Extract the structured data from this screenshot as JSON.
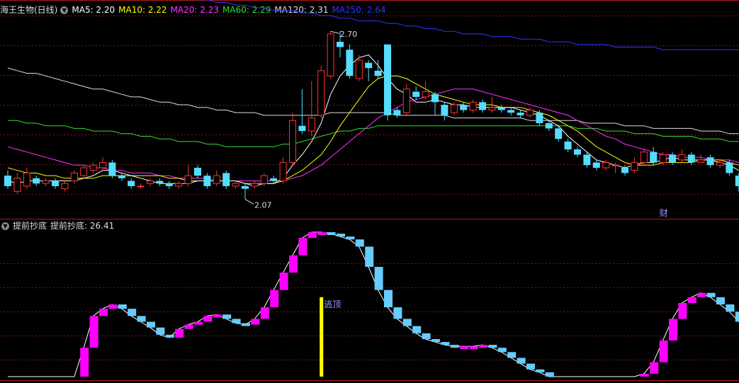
{
  "main_header": {
    "stock_name": "海王生物(日线)",
    "ma": [
      {
        "label": "MA5: 2.20",
        "color": "#ffffff"
      },
      {
        "label": "MA10: 2.22",
        "color": "#ffff00"
      },
      {
        "label": "MA20: 2.23",
        "color": "#ff33ff"
      },
      {
        "label": "MA60: 2.29",
        "color": "#33dd33"
      },
      {
        "label": "MA120: 2.31",
        "color": "#dddddd"
      },
      {
        "label": "MA250: 2.64",
        "color": "#3333ff"
      }
    ]
  },
  "sub_header": {
    "indicator": "提前抄底",
    "value_label": "提前抄底: 26.41"
  },
  "annotations": {
    "high_label": "2.70",
    "low_label": "2.07",
    "event_label": "财",
    "signal_label": "逃顶"
  },
  "colors": {
    "up_candle": "#ff3333",
    "down_candle": "#55ddff",
    "grid": "#7a1a1a",
    "ma5": "#ffffff",
    "ma10": "#ffff00",
    "ma20": "#ff33ff",
    "ma60": "#33dd33",
    "ma120": "#dddddd",
    "ma250": "#3333ff",
    "ind_up": "#ff00ff",
    "ind_down": "#66ccff",
    "signal_bar": "#ffff00"
  },
  "chart_data": [
    {
      "type": "candlestick",
      "ylim": [
        2.02,
        2.77
      ],
      "candles": [
        {
          "o": 2.16,
          "c": 2.12,
          "h": 2.18,
          "l": 2.11
        },
        {
          "o": 2.1,
          "c": 2.15,
          "h": 2.17,
          "l": 2.09
        },
        {
          "o": 2.12,
          "c": 2.17,
          "h": 2.19,
          "l": 2.11
        },
        {
          "o": 2.15,
          "c": 2.13,
          "h": 2.16,
          "l": 2.12
        },
        {
          "o": 2.13,
          "c": 2.14,
          "h": 2.15,
          "l": 2.12
        },
        {
          "o": 2.14,
          "c": 2.12,
          "h": 2.15,
          "l": 2.11
        },
        {
          "o": 2.11,
          "c": 2.13,
          "h": 2.14,
          "l": 2.1
        },
        {
          "o": 2.14,
          "c": 2.17,
          "h": 2.18,
          "l": 2.13
        },
        {
          "o": 2.16,
          "c": 2.19,
          "h": 2.2,
          "l": 2.15
        },
        {
          "o": 2.18,
          "c": 2.2,
          "h": 2.21,
          "l": 2.17
        },
        {
          "o": 2.19,
          "c": 2.21,
          "h": 2.23,
          "l": 2.18
        },
        {
          "o": 2.21,
          "c": 2.16,
          "h": 2.22,
          "l": 2.15
        },
        {
          "o": 2.16,
          "c": 2.15,
          "h": 2.17,
          "l": 2.14
        },
        {
          "o": 2.14,
          "c": 2.12,
          "h": 2.15,
          "l": 2.11
        },
        {
          "o": 2.12,
          "c": 2.12,
          "h": 2.13,
          "l": 2.11
        },
        {
          "o": 2.13,
          "c": 2.14,
          "h": 2.15,
          "l": 2.12
        },
        {
          "o": 2.14,
          "c": 2.13,
          "h": 2.15,
          "l": 2.12
        },
        {
          "o": 2.13,
          "c": 2.12,
          "h": 2.14,
          "l": 2.11
        },
        {
          "o": 2.12,
          "c": 2.13,
          "h": 2.14,
          "l": 2.11
        },
        {
          "o": 2.13,
          "c": 2.16,
          "h": 2.2,
          "l": 2.12
        },
        {
          "o": 2.19,
          "c": 2.16,
          "h": 2.2,
          "l": 2.15
        },
        {
          "o": 2.16,
          "c": 2.12,
          "h": 2.17,
          "l": 2.11
        },
        {
          "o": 2.13,
          "c": 2.16,
          "h": 2.18,
          "l": 2.12
        },
        {
          "o": 2.17,
          "c": 2.12,
          "h": 2.18,
          "l": 2.11
        },
        {
          "o": 2.12,
          "c": 2.13,
          "h": 2.14,
          "l": 2.11
        },
        {
          "o": 2.12,
          "c": 2.11,
          "h": 2.13,
          "l": 2.07
        },
        {
          "o": 2.12,
          "c": 2.13,
          "h": 2.14,
          "l": 2.11
        },
        {
          "o": 2.13,
          "c": 2.16,
          "h": 2.17,
          "l": 2.12
        },
        {
          "o": 2.15,
          "c": 2.14,
          "h": 2.16,
          "l": 2.13
        },
        {
          "o": 2.14,
          "c": 2.21,
          "h": 2.23,
          "l": 2.13
        },
        {
          "o": 2.21,
          "c": 2.37,
          "h": 2.4,
          "l": 2.2
        },
        {
          "o": 2.35,
          "c": 2.33,
          "h": 2.49,
          "l": 2.32
        },
        {
          "o": 2.33,
          "c": 2.38,
          "h": 2.52,
          "l": 2.31
        },
        {
          "o": 2.39,
          "c": 2.56,
          "h": 2.58,
          "l": 2.38
        },
        {
          "o": 2.54,
          "c": 2.7,
          "h": 2.71,
          "l": 2.53
        },
        {
          "o": 2.67,
          "c": 2.65,
          "h": 2.71,
          "l": 2.61
        },
        {
          "o": 2.64,
          "c": 2.54,
          "h": 2.66,
          "l": 2.53
        },
        {
          "o": 2.53,
          "c": 2.6,
          "h": 2.62,
          "l": 2.52
        },
        {
          "o": 2.59,
          "c": 2.57,
          "h": 2.6,
          "l": 2.52
        },
        {
          "o": 2.56,
          "c": 2.54,
          "h": 2.6,
          "l": 2.53
        },
        {
          "o": 2.66,
          "c": 2.39,
          "h": 2.66,
          "l": 2.37
        },
        {
          "o": 2.41,
          "c": 2.39,
          "h": 2.42,
          "l": 2.38
        },
        {
          "o": 2.4,
          "c": 2.49,
          "h": 2.51,
          "l": 2.39
        },
        {
          "o": 2.48,
          "c": 2.46,
          "h": 2.5,
          "l": 2.45
        },
        {
          "o": 2.46,
          "c": 2.48,
          "h": 2.52,
          "l": 2.45
        },
        {
          "o": 2.47,
          "c": 2.44,
          "h": 2.48,
          "l": 2.39
        },
        {
          "o": 2.43,
          "c": 2.39,
          "h": 2.44,
          "l": 2.37
        },
        {
          "o": 2.4,
          "c": 2.43,
          "h": 2.44,
          "l": 2.39
        },
        {
          "o": 2.43,
          "c": 2.41,
          "h": 2.44,
          "l": 2.4
        },
        {
          "o": 2.41,
          "c": 2.44,
          "h": 2.45,
          "l": 2.4
        },
        {
          "o": 2.44,
          "c": 2.41,
          "h": 2.45,
          "l": 2.4
        },
        {
          "o": 2.41,
          "c": 2.42,
          "h": 2.46,
          "l": 2.4
        },
        {
          "o": 2.42,
          "c": 2.41,
          "h": 2.43,
          "l": 2.4
        },
        {
          "o": 2.41,
          "c": 2.4,
          "h": 2.42,
          "l": 2.39
        },
        {
          "o": 2.4,
          "c": 2.39,
          "h": 2.41,
          "l": 2.38
        },
        {
          "o": 2.39,
          "c": 2.41,
          "h": 2.42,
          "l": 2.38
        },
        {
          "o": 2.4,
          "c": 2.36,
          "h": 2.41,
          "l": 2.35
        },
        {
          "o": 2.36,
          "c": 2.34,
          "h": 2.37,
          "l": 2.33
        },
        {
          "o": 2.34,
          "c": 2.3,
          "h": 2.35,
          "l": 2.29
        },
        {
          "o": 2.29,
          "c": 2.26,
          "h": 2.3,
          "l": 2.25
        },
        {
          "o": 2.26,
          "c": 2.24,
          "h": 2.27,
          "l": 2.23
        },
        {
          "o": 2.24,
          "c": 2.2,
          "h": 2.25,
          "l": 2.19
        },
        {
          "o": 2.21,
          "c": 2.19,
          "h": 2.22,
          "l": 2.18
        },
        {
          "o": 2.19,
          "c": 2.21,
          "h": 2.22,
          "l": 2.18
        },
        {
          "o": 2.2,
          "c": 2.2,
          "h": 2.21,
          "l": 2.17
        },
        {
          "o": 2.19,
          "c": 2.17,
          "h": 2.2,
          "l": 2.16
        },
        {
          "o": 2.18,
          "c": 2.21,
          "h": 2.23,
          "l": 2.17
        },
        {
          "o": 2.21,
          "c": 2.25,
          "h": 2.26,
          "l": 2.2
        },
        {
          "o": 2.25,
          "c": 2.21,
          "h": 2.27,
          "l": 2.2
        },
        {
          "o": 2.21,
          "c": 2.24,
          "h": 2.25,
          "l": 2.2
        },
        {
          "o": 2.24,
          "c": 2.21,
          "h": 2.25,
          "l": 2.2
        },
        {
          "o": 2.22,
          "c": 2.24,
          "h": 2.26,
          "l": 2.21
        },
        {
          "o": 2.24,
          "c": 2.21,
          "h": 2.25,
          "l": 2.2
        },
        {
          "o": 2.21,
          "c": 2.22,
          "h": 2.24,
          "l": 2.21
        },
        {
          "o": 2.23,
          "c": 2.2,
          "h": 2.24,
          "l": 2.19
        },
        {
          "o": 2.2,
          "c": 2.21,
          "h": 2.22,
          "l": 2.19
        },
        {
          "o": 2.21,
          "c": 2.17,
          "h": 2.22,
          "l": 2.16
        },
        {
          "o": 2.16,
          "c": 2.12,
          "h": 2.17,
          "l": 2.1
        }
      ],
      "ma5": [
        2.14,
        2.13,
        2.14,
        2.14,
        2.14,
        2.14,
        2.14,
        2.14,
        2.15,
        2.16,
        2.18,
        2.18,
        2.17,
        2.16,
        2.15,
        2.14,
        2.13,
        2.13,
        2.13,
        2.13,
        2.14,
        2.14,
        2.14,
        2.14,
        2.14,
        2.13,
        2.12,
        2.13,
        2.13,
        2.15,
        2.2,
        2.24,
        2.29,
        2.36,
        2.47,
        2.54,
        2.58,
        2.61,
        2.62,
        2.58,
        2.53,
        2.49,
        2.47,
        2.44,
        2.44,
        2.45,
        2.44,
        2.43,
        2.43,
        2.42,
        2.42,
        2.42,
        2.42,
        2.42,
        2.41,
        2.4,
        2.39,
        2.37,
        2.35,
        2.31,
        2.28,
        2.25,
        2.22,
        2.21,
        2.2,
        2.19,
        2.2,
        2.21,
        2.21,
        2.22,
        2.23,
        2.22,
        2.22,
        2.22,
        2.22,
        2.21,
        2.2,
        2.18
      ],
      "ma10": [
        2.19,
        2.18,
        2.17,
        2.17,
        2.16,
        2.16,
        2.15,
        2.15,
        2.15,
        2.15,
        2.16,
        2.16,
        2.16,
        2.16,
        2.16,
        2.16,
        2.16,
        2.15,
        2.15,
        2.14,
        2.14,
        2.14,
        2.14,
        2.14,
        2.14,
        2.13,
        2.13,
        2.13,
        2.13,
        2.14,
        2.16,
        2.18,
        2.21,
        2.24,
        2.29,
        2.35,
        2.4,
        2.45,
        2.5,
        2.53,
        2.54,
        2.54,
        2.53,
        2.51,
        2.49,
        2.47,
        2.46,
        2.45,
        2.44,
        2.43,
        2.43,
        2.43,
        2.42,
        2.42,
        2.42,
        2.41,
        2.4,
        2.39,
        2.37,
        2.35,
        2.33,
        2.3,
        2.27,
        2.25,
        2.23,
        2.21,
        2.2,
        2.2,
        2.2,
        2.21,
        2.21,
        2.21,
        2.21,
        2.22,
        2.22,
        2.22,
        2.21,
        2.2
      ],
      "ma20": [
        2.27,
        2.26,
        2.25,
        2.24,
        2.23,
        2.22,
        2.21,
        2.2,
        2.2,
        2.19,
        2.19,
        2.18,
        2.18,
        2.17,
        2.17,
        2.17,
        2.16,
        2.16,
        2.15,
        2.15,
        2.15,
        2.15,
        2.14,
        2.14,
        2.14,
        2.14,
        2.14,
        2.14,
        2.14,
        2.14,
        2.15,
        2.16,
        2.18,
        2.2,
        2.23,
        2.26,
        2.29,
        2.32,
        2.35,
        2.38,
        2.4,
        2.42,
        2.44,
        2.45,
        2.46,
        2.47,
        2.48,
        2.49,
        2.49,
        2.49,
        2.48,
        2.47,
        2.46,
        2.45,
        2.44,
        2.43,
        2.42,
        2.41,
        2.4,
        2.39,
        2.37,
        2.35,
        2.33,
        2.31,
        2.3,
        2.28,
        2.27,
        2.26,
        2.25,
        2.24,
        2.24,
        2.23,
        2.23,
        2.23,
        2.22,
        2.22,
        2.22,
        2.21
      ],
      "ma60": [
        2.37,
        2.37,
        2.36,
        2.36,
        2.35,
        2.35,
        2.35,
        2.34,
        2.34,
        2.33,
        2.33,
        2.33,
        2.32,
        2.32,
        2.31,
        2.31,
        2.3,
        2.3,
        2.29,
        2.29,
        2.29,
        2.28,
        2.28,
        2.27,
        2.27,
        2.27,
        2.27,
        2.27,
        2.27,
        2.28,
        2.28,
        2.29,
        2.3,
        2.31,
        2.32,
        2.33,
        2.33,
        2.34,
        2.34,
        2.35,
        2.35,
        2.35,
        2.35,
        2.35,
        2.35,
        2.35,
        2.35,
        2.35,
        2.35,
        2.35,
        2.35,
        2.35,
        2.35,
        2.35,
        2.35,
        2.35,
        2.35,
        2.35,
        2.35,
        2.35,
        2.34,
        2.34,
        2.34,
        2.33,
        2.33,
        2.33,
        2.32,
        2.32,
        2.32,
        2.31,
        2.31,
        2.31,
        2.31,
        2.3,
        2.3,
        2.3,
        2.29,
        2.29
      ],
      "ma120": [
        2.57,
        2.56,
        2.55,
        2.55,
        2.54,
        2.53,
        2.52,
        2.51,
        2.5,
        2.49,
        2.49,
        2.48,
        2.47,
        2.46,
        2.46,
        2.45,
        2.44,
        2.44,
        2.43,
        2.43,
        2.42,
        2.42,
        2.41,
        2.41,
        2.4,
        2.4,
        2.4,
        2.39,
        2.39,
        2.39,
        2.39,
        2.39,
        2.39,
        2.39,
        2.4,
        2.4,
        2.4,
        2.4,
        2.4,
        2.4,
        2.4,
        2.39,
        2.39,
        2.39,
        2.39,
        2.39,
        2.39,
        2.38,
        2.38,
        2.38,
        2.38,
        2.38,
        2.38,
        2.38,
        2.38,
        2.37,
        2.37,
        2.37,
        2.37,
        2.37,
        2.37,
        2.36,
        2.36,
        2.36,
        2.36,
        2.35,
        2.35,
        2.35,
        2.34,
        2.34,
        2.34,
        2.34,
        2.34,
        2.33,
        2.33,
        2.33,
        2.32,
        2.32
      ],
      "ma250": [
        2.92,
        2.92,
        2.91,
        2.91,
        2.9,
        2.9,
        2.89,
        2.89,
        2.88,
        2.88,
        2.87,
        2.87,
        2.86,
        2.86,
        2.86,
        2.85,
        2.85,
        2.84,
        2.84,
        2.84,
        2.83,
        2.83,
        2.82,
        2.82,
        2.81,
        2.81,
        2.8,
        2.8,
        2.79,
        2.79,
        2.79,
        2.78,
        2.78,
        2.77,
        2.77,
        2.76,
        2.76,
        2.75,
        2.75,
        2.75,
        2.74,
        2.74,
        2.73,
        2.73,
        2.72,
        2.72,
        2.71,
        2.71,
        2.7,
        2.7,
        2.7,
        2.69,
        2.69,
        2.69,
        2.68,
        2.68,
        2.68,
        2.67,
        2.67,
        2.67,
        2.66,
        2.66,
        2.66,
        2.66,
        2.65,
        2.65,
        2.65,
        2.65,
        2.65,
        2.64,
        2.64,
        2.64,
        2.64,
        2.64,
        2.64,
        2.64,
        2.64,
        2.64
      ]
    },
    {
      "type": "bar",
      "ylim": [
        0,
        100
      ],
      "values": [
        0,
        0,
        0,
        0,
        0,
        0,
        0,
        0,
        20,
        42,
        47,
        50,
        47,
        42,
        38,
        34,
        29,
        27,
        33,
        36,
        38,
        42,
        43,
        40,
        37,
        36,
        40,
        48,
        60,
        72,
        84,
        96,
        100,
        100,
        99,
        97,
        95,
        90,
        76,
        60,
        48,
        40,
        35,
        30,
        26,
        24,
        22,
        21,
        21,
        21,
        22,
        20,
        17,
        13,
        9,
        5,
        3,
        0,
        0,
        0,
        0,
        0,
        0,
        0,
        0,
        0,
        0,
        2,
        10,
        25,
        40,
        51,
        55,
        58,
        55,
        50,
        45,
        38
      ],
      "signal_index": 33,
      "signal_value": 55
    }
  ]
}
